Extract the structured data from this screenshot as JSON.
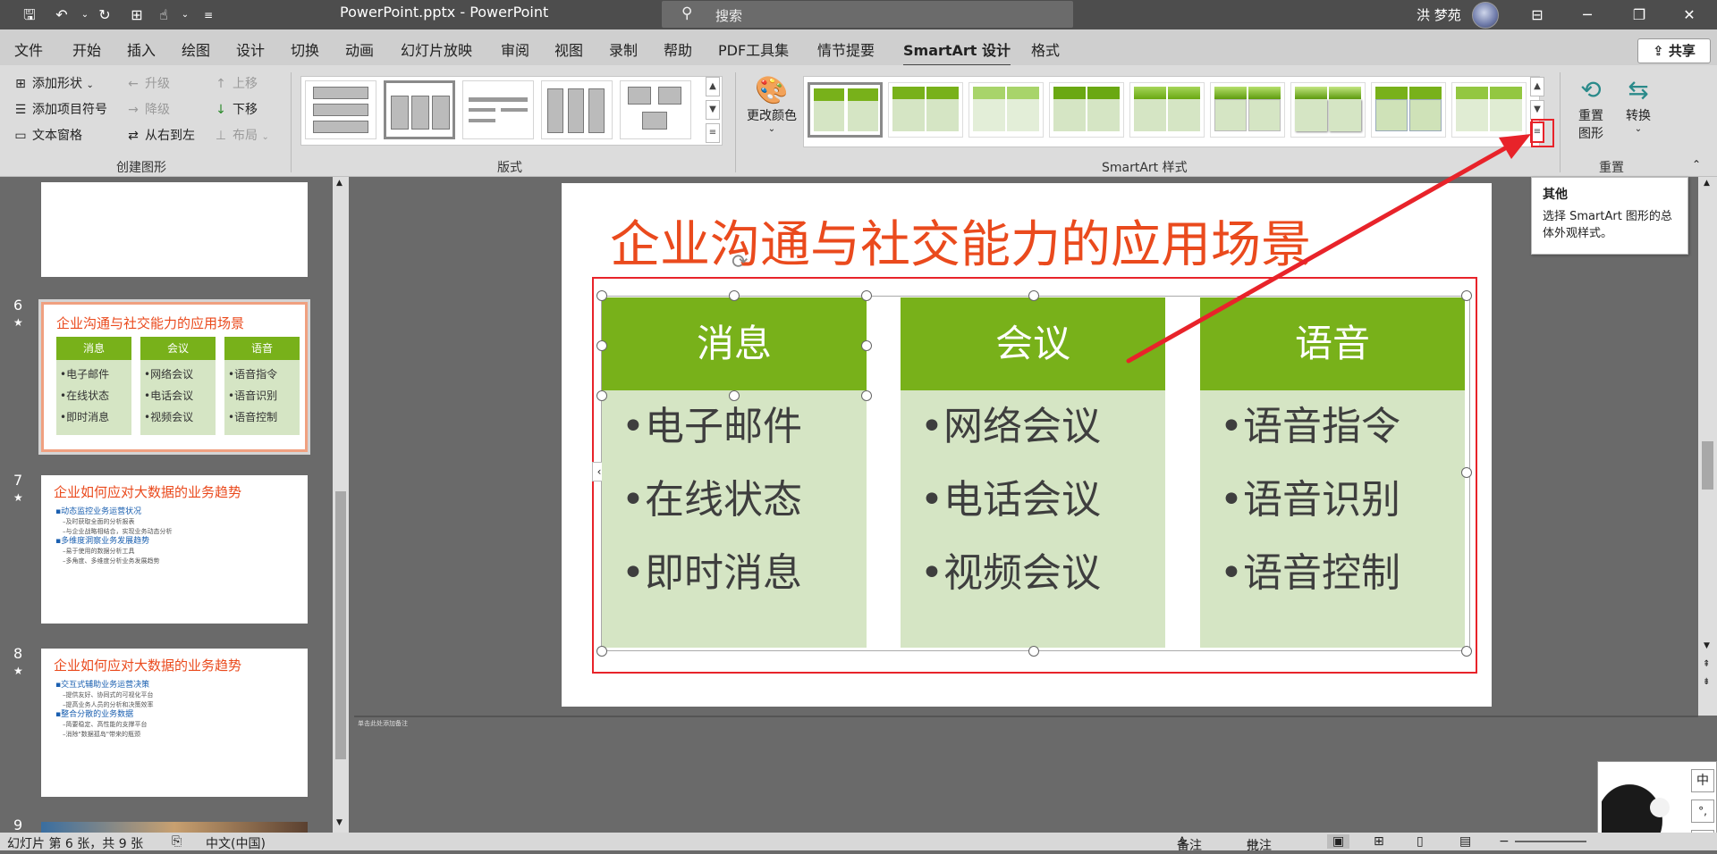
{
  "title": "PowerPoint.pptx  -  PowerPoint",
  "search": {
    "placeholder": "搜索"
  },
  "user": {
    "name": "洪 梦苑"
  },
  "tabs": [
    "文件",
    "开始",
    "插入",
    "绘图",
    "设计",
    "切换",
    "动画",
    "幻灯片放映",
    "审阅",
    "视图",
    "录制",
    "帮助",
    "PDF工具集",
    "情节提要",
    "SmartArt 设计",
    "格式"
  ],
  "active_tab": "SmartArt 设计",
  "share_label": "共享",
  "ribbon": {
    "create_group": {
      "label": "创建图形",
      "add_shape": "添加形状",
      "add_bullet": "添加项目符号",
      "text_pane": "文本窗格",
      "promote": "升级",
      "demote": "降级",
      "right_to_left": "从右到左",
      "move_up": "上移",
      "move_down": "下移",
      "layout": "布局"
    },
    "layouts_label": "版式",
    "change_colors": "更改颜色",
    "styles_label": "SmartArt 样式",
    "reset_label": "重置",
    "reset_graphic": [
      "重置",
      "图形"
    ],
    "convert": "转换"
  },
  "tooltip": {
    "title": "其他",
    "body": "选择 SmartArt 图形的总体外观样式。"
  },
  "thumbnails": [
    {
      "num": "6",
      "title": "企业沟通与社交能力的应用场景",
      "cols": [
        {
          "head": "消息",
          "items": [
            "•电子邮件",
            "•在线状态",
            "•即时消息"
          ]
        },
        {
          "head": "会议",
          "items": [
            "•网络会议",
            "•电话会议",
            "•视频会议"
          ]
        },
        {
          "head": "语音",
          "items": [
            "•语音指令",
            "•语音识别",
            "•语音控制"
          ]
        }
      ]
    },
    {
      "num": "7",
      "title": "企业如何应对大数据的业务趋势",
      "lines": [
        "▪动态监控业务运营状况",
        "–及时获取全面的分析报表",
        "–与企业战略相结合，实现业务动态分析",
        "▪多维度洞察业务发展趋势",
        "–易于使用的数据分析工具",
        "–多角度、多维度分析业务发展趋势"
      ]
    },
    {
      "num": "8",
      "title": "企业如何应对大数据的业务趋势",
      "lines": [
        "▪交互式辅助业务运营决策",
        "–提供友好、协同式的可视化平台",
        "–提高业务人员的分析和决策效率",
        "▪整合分散的业务数据",
        "–简要稳定、高性能的支撑平台",
        "–消除\"数据孤岛\"带来的瓶颈"
      ]
    },
    {
      "num": "9"
    }
  ],
  "slide": {
    "title": "企业沟通与社交能力的应用场景",
    "columns": [
      {
        "head": "消息",
        "items": [
          "•电子邮件",
          "•在线状态",
          "•即时消息"
        ]
      },
      {
        "head": "会议",
        "items": [
          "•网络会议",
          "•电话会议",
          "•视频会议"
        ]
      },
      {
        "head": "语音",
        "items": [
          "•语音指令",
          "•语音识别",
          "•语音控制"
        ]
      }
    ]
  },
  "notes_placeholder": "单击此处添加备注",
  "status": {
    "slide_info": "幻灯片 第 6 张，共 9 张",
    "language": "中文(中国)",
    "notes": "备注",
    "comments": "批注"
  },
  "ime": {
    "lang": "中",
    "punct": "°,"
  },
  "colors": {
    "accent_orange": "#ea4a1d",
    "smartart_green": "#78b11a",
    "smartart_light": "#d5e5c4",
    "annotation_red": "#e8232a"
  }
}
